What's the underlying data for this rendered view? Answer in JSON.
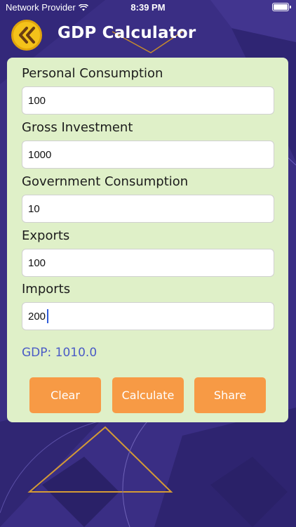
{
  "status_bar": {
    "carrier": "Network Provider",
    "time": "8:39 PM"
  },
  "header": {
    "title": "GDP Calculator",
    "back_icon": "double-chevron-left-icon"
  },
  "form": {
    "fields": [
      {
        "label": "Personal Consumption",
        "value": "100"
      },
      {
        "label": "Gross Investment",
        "value": "1000"
      },
      {
        "label": "Government Consumption",
        "value": "10"
      },
      {
        "label": "Exports",
        "value": "100"
      },
      {
        "label": "Imports",
        "value": "200"
      }
    ],
    "result": "GDP: 1010.0"
  },
  "buttons": {
    "clear": "Clear",
    "calculate": "Calculate",
    "share": "Share"
  },
  "colors": {
    "background": "#3b2f86",
    "card": "#dff0c8",
    "accent": "#f79a45",
    "result_text": "#4a5bc6",
    "back_button": "#f4c21a"
  }
}
